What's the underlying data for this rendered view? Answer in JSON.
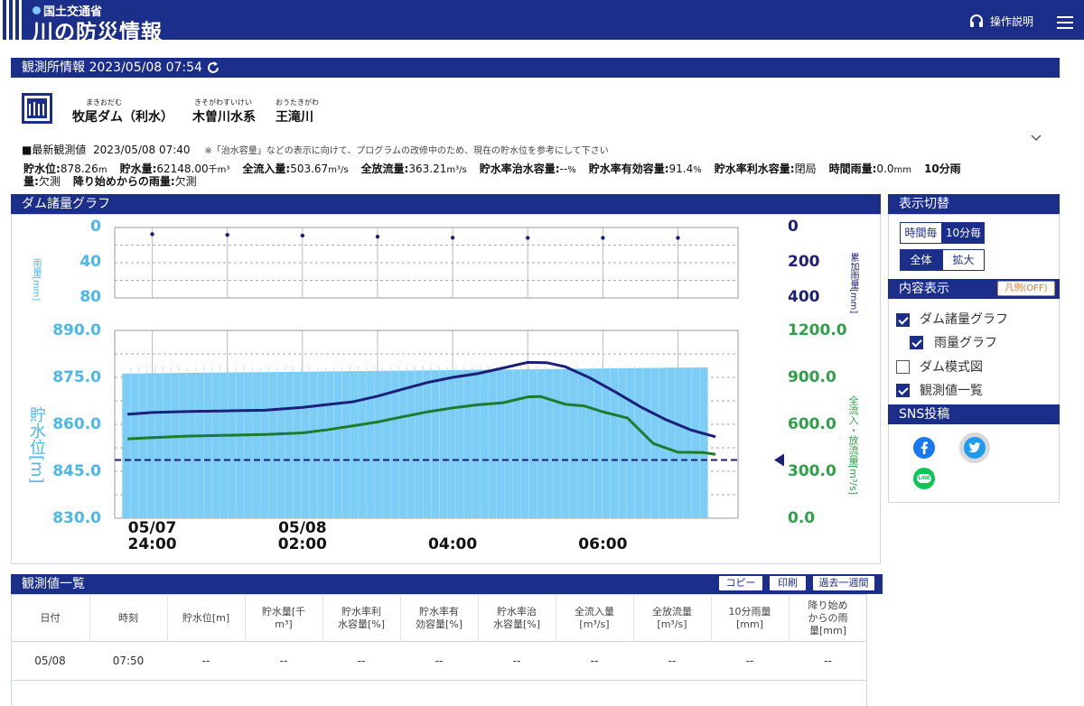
{
  "header": {
    "ministry": "国土交通省",
    "app_title": "川の防災情報",
    "help_label": "操作説明"
  },
  "station_bar": {
    "title": "観測所情報 2023/05/08 07:54"
  },
  "station": {
    "name": "牧尾ダム（利水）",
    "name_ruby": "まきおだむ",
    "system": "木曽川水系",
    "system_ruby": "きそがわすいけい",
    "river": "王滝川",
    "river_ruby": "おうたきがわ"
  },
  "latest": {
    "label": "■最新観測値",
    "time": "2023/05/08 07:40",
    "note": "※「治水容量」などの表示に向けて、プログラムの改修中のため、現在の貯水位を参考にして下さい",
    "line1": [
      {
        "label": "貯水位:",
        "value": "878.26",
        "unit": "m"
      },
      {
        "label": "貯水量:",
        "value": "62148.00",
        "unit": "千m³"
      },
      {
        "label": "全流入量:",
        "value": "503.67",
        "unit": "m³/s"
      },
      {
        "label": "全放流量:",
        "value": "363.21",
        "unit": "m³/s"
      },
      {
        "label": "貯水率治水容量:",
        "value": "--",
        "unit": "%"
      },
      {
        "label": "貯水率有効容量:",
        "value": "91.4",
        "unit": "%"
      },
      {
        "label": "貯水率利水容量:",
        "value": "閉局",
        "unit": ""
      },
      {
        "label": "時間雨量:",
        "value": "0.0",
        "unit": "mm"
      },
      {
        "label": "10分雨",
        "value": "",
        "unit": ""
      }
    ],
    "line2": [
      {
        "label": "量:",
        "value": "欠測",
        "unit": ""
      },
      {
        "label": "降り始めからの雨量:",
        "value": "欠測",
        "unit": ""
      }
    ]
  },
  "graph_bar": {
    "title": "ダム諸量グラフ"
  },
  "chart_data": {
    "type": "line",
    "rain_axis": {
      "left_ticks": [
        "0",
        "40",
        "80"
      ],
      "left_label": "雨量[mm]",
      "right_ticks": [
        "0",
        "200",
        "400"
      ],
      "right_label": "累加雨量[mm]"
    },
    "level_axis": {
      "left_ticks": [
        "890.0",
        "875.0",
        "860.0",
        "845.0",
        "830.0"
      ],
      "left_label": "貯水位[m]",
      "ylim": [
        830,
        890
      ]
    },
    "flow_axis": {
      "right_ticks": [
        "1200.0",
        "900.0",
        "600.0",
        "300.0",
        "0.0"
      ],
      "right_label": "全流入・放流量[m³/s]",
      "ylim": [
        0,
        1200
      ]
    },
    "x_ticks": [
      {
        "line1": "05/07",
        "line2": "24:00"
      },
      {
        "line1": "05/08",
        "line2": "02:00"
      },
      {
        "line1": "",
        "line2": "04:00"
      },
      {
        "line1": "",
        "line2": "06:00"
      }
    ],
    "x_hours": [
      0,
      2,
      4,
      6
    ],
    "xlim": [
      -0.5,
      7.8
    ],
    "cumulative_rain_points": {
      "x": [
        0,
        1,
        2,
        3,
        4,
        5,
        6,
        7
      ],
      "y": [
        38,
        42,
        46,
        52,
        58,
        59,
        59,
        59
      ],
      "ylim": [
        0,
        400
      ]
    },
    "level_fill": {
      "x": [
        -0.4,
        7.4
      ],
      "y": [
        876.2,
        878.2
      ]
    },
    "series": [
      {
        "color": "#1a1f78",
        "x": [
          -0.33,
          0,
          0.5,
          1,
          1.5,
          2,
          2.33,
          2.67,
          3,
          3.33,
          3.67,
          4,
          4.33,
          4.67,
          5,
          5.25,
          5.5,
          5.83,
          6.17,
          6.5,
          6.83,
          7.17,
          7.5
        ],
        "y": [
          863.2,
          863.8,
          864.1,
          864.3,
          864.5,
          865.4,
          866.3,
          867.2,
          869.0,
          871.2,
          873.4,
          875.0,
          876.2,
          878.0,
          879.8,
          879.7,
          878.4,
          874.8,
          870.3,
          865.6,
          861.6,
          858.2,
          856.0
        ]
      },
      {
        "color": "#1e7a2c",
        "x": [
          -0.33,
          0,
          0.5,
          1,
          1.5,
          2,
          2.33,
          2.67,
          3,
          3.33,
          3.67,
          4,
          4.33,
          4.67,
          5,
          5.17,
          5.5,
          5.75,
          6,
          6.33,
          6.67,
          7,
          7.33,
          7.5
        ],
        "y": [
          507,
          515,
          525,
          530,
          535,
          545,
          565,
          590,
          615,
          648,
          680,
          705,
          725,
          738,
          775,
          778,
          728,
          718,
          680,
          640,
          478,
          422,
          420,
          408
        ]
      }
    ],
    "reference_level": 848.6
  },
  "sidebar": {
    "display_title": "表示切替",
    "hourly": "時間毎",
    "ten_min": "10分毎",
    "all": "全体",
    "zoom": "拡大",
    "content_title": "内容表示",
    "legend_btn": "凡例(OFF)",
    "options": [
      {
        "label": "ダム諸量グラフ",
        "checked": true
      },
      {
        "label": "雨量グラフ",
        "checked": true
      },
      {
        "label": "ダム模式図",
        "checked": false
      },
      {
        "label": "観測値一覧",
        "checked": true
      }
    ],
    "sns_title": "SNS投稿",
    "line_text": "LINE"
  },
  "table": {
    "title": "観測値一覧",
    "buttons": [
      "コピー",
      "印刷",
      "過去一週間"
    ],
    "headers": [
      [
        "日付"
      ],
      [
        "時刻"
      ],
      [
        "貯水位[m]"
      ],
      [
        "貯水量[千",
        "m³]"
      ],
      [
        "貯水率利",
        "水容量[%]"
      ],
      [
        "貯水率有",
        "効容量[%]"
      ],
      [
        "貯水率治",
        "水容量[%]"
      ],
      [
        "全流入量",
        "[m³/s]"
      ],
      [
        "全放流量",
        "[m³/s]"
      ],
      [
        "10分雨量",
        "[mm]"
      ],
      [
        "降り始め",
        "からの雨",
        "量[mm]"
      ]
    ],
    "rows": [
      [
        "05/08",
        "07:50",
        "--",
        "--",
        "--",
        "--",
        "--",
        "--",
        "--",
        "--",
        "--"
      ]
    ]
  }
}
